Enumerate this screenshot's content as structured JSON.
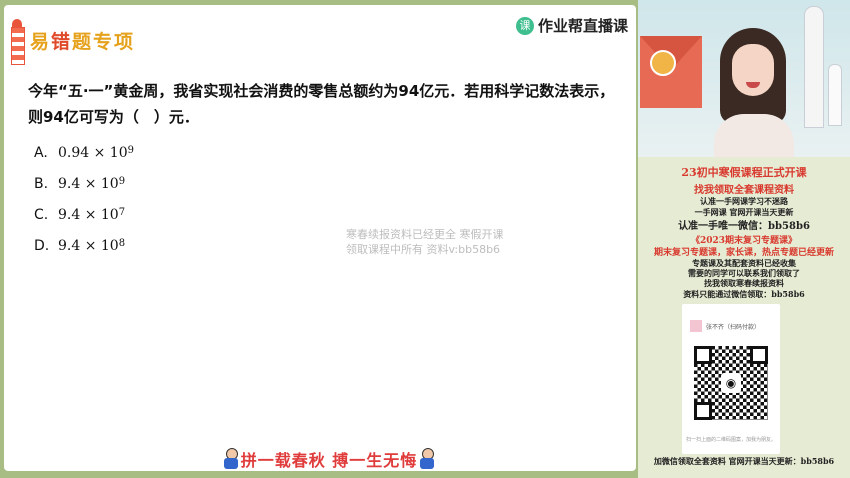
{
  "slide": {
    "topic_chars": [
      "易",
      "错",
      "题",
      "专项"
    ],
    "brand_icon": "课",
    "brand_name": "作业帮直播课",
    "question": "今年“五·一”黄金周，我省实现社会消费的零售总额约为94亿元．若用科学记数法表示，则94亿可写为（　）元．",
    "options": [
      {
        "label": "A.",
        "base": "0.94 × 10",
        "exp": "9"
      },
      {
        "label": "B.",
        "base": "9.4 × 10",
        "exp": "9"
      },
      {
        "label": "C.",
        "base": "9.4 × 10",
        "exp": "7"
      },
      {
        "label": "D.",
        "base": "9.4 × 10",
        "exp": "8"
      }
    ],
    "watermark_line1": "寒春续报资料已经更全 寒假开课",
    "watermark_line2": "领取课程中所有  资料v:bb58b6",
    "slogan": "拼一载春秋 搏一生无悔"
  },
  "ad": {
    "line1": "23初中寒假课程正式开课",
    "line2": "找我领取全套课程资料",
    "line3": "认准一手网课学习不迷路",
    "line4": "一手网课  官网开课当天更新",
    "line5": "认准一手唯一微信：bb58b6",
    "line6": "《2023期末复习专题课》",
    "line7": "期末复习专题课，家长课，热点专题已经更新",
    "line8": "专题课及其配套资料已经收集",
    "line9": "需要的同学可以联系我们领取了",
    "line10": "找我领取寒春续报资料",
    "line11": "资料只能通过微信领取：bb58b6",
    "card_name": "张不齐（扫码付款）",
    "card_footer": "扫一扫上面的二维码图案，加我为朋友。",
    "line12": "加微信领取全套资料  官网开课当天更新：bb58b6"
  }
}
